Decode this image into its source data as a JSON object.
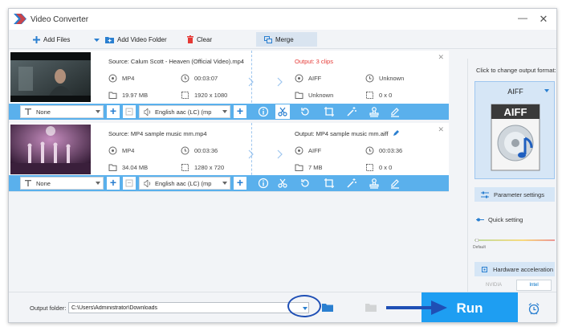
{
  "window": {
    "title": "Video Converter",
    "minimize": "—",
    "close": "✕"
  },
  "toolbar": {
    "add_files": "Add Files",
    "add_video_folder": "Add Video Folder",
    "clear": "Clear",
    "merge": "Merge"
  },
  "items": [
    {
      "source": "Source: Calum Scott - Heaven (Official Video).mp4",
      "output": "Output: 3 clips",
      "src_format": "MP4",
      "src_duration": "00:03:07",
      "src_size": "19.97 MB",
      "src_resolution": "1920 x 1080",
      "out_format": "AIFF",
      "out_duration": "Unknown",
      "out_size": "Unknown",
      "out_resolution": "0 x 0",
      "subtitle": "None",
      "audio": "English aac (LC) (mp"
    },
    {
      "source": "Source: MP4 sample music mm.mp4",
      "output": "Output: MP4 sample music mm.aiff",
      "src_format": "MP4",
      "src_duration": "00:03:36",
      "src_size": "34.04 MB",
      "src_resolution": "1280 x 720",
      "out_format": "AIFF",
      "out_duration": "00:03:36",
      "out_size": "7 MB",
      "out_resolution": "0 x 0",
      "subtitle": "None",
      "audio": "English aac (LC) (mp"
    }
  ],
  "right_panel": {
    "hint": "Click to change output format:",
    "format": "AIFF",
    "format_icon_text": "AIFF",
    "parameter_settings": "Parameter settings",
    "quick_setting": "Quick setting",
    "slider_default": "Default",
    "hardware_acceleration": "Hardware acceleration",
    "nvidia": "NVIDIA",
    "intel": "Intel"
  },
  "bottom": {
    "output_folder_label": "Output folder:",
    "output_folder_value": "C:\\Users\\Administrator\\Downloads",
    "run": "Run"
  },
  "colors": {
    "accent": "#1e9ef2",
    "edit_bar": "#5ab0ec",
    "output_red": "#e53935",
    "annotation": "#1f4fb5"
  }
}
